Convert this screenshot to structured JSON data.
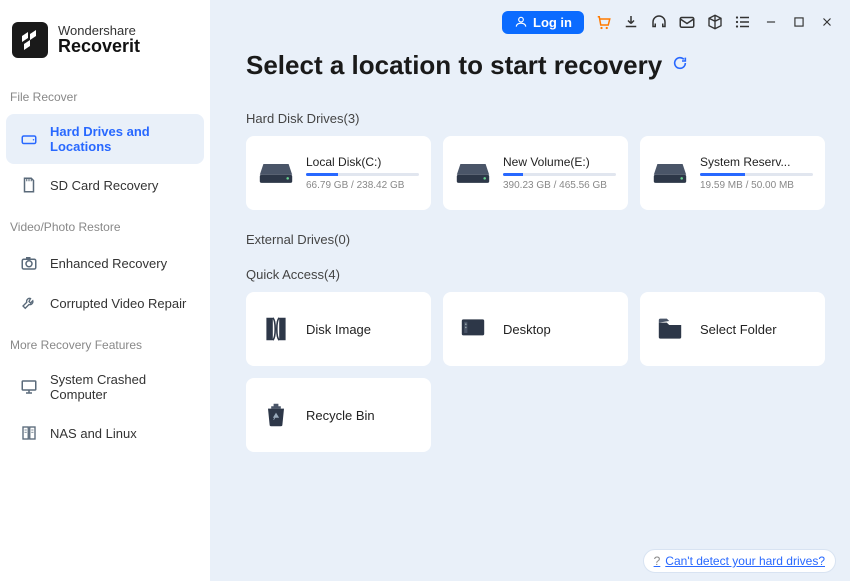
{
  "brand": {
    "line1": "Wondershare",
    "line2": "Recoverit"
  },
  "sidebar": {
    "groups": [
      {
        "label": "File Recover",
        "items": [
          {
            "icon": "drive",
            "label": "Hard Drives and Locations",
            "active": true
          },
          {
            "icon": "sd",
            "label": "SD Card Recovery",
            "active": false
          }
        ]
      },
      {
        "label": "Video/Photo Restore",
        "items": [
          {
            "icon": "camera",
            "label": "Enhanced Recovery",
            "active": false
          },
          {
            "icon": "wrench",
            "label": "Corrupted Video Repair",
            "active": false
          }
        ]
      },
      {
        "label": "More Recovery Features",
        "items": [
          {
            "icon": "monitor",
            "label": "System Crashed Computer",
            "active": false
          },
          {
            "icon": "nas",
            "label": "NAS and Linux",
            "active": false
          }
        ]
      }
    ]
  },
  "titlebar": {
    "login": "Log in",
    "icons": [
      "cart",
      "download",
      "headset",
      "mail",
      "cube",
      "list",
      "minimize",
      "maximize",
      "close"
    ]
  },
  "heading": "Select a location to start recovery",
  "sections": {
    "hdd": {
      "title": "Hard Disk Drives(3)",
      "items": [
        {
          "name": "Local Disk(C:)",
          "used": "66.79 GB",
          "total": "238.42 GB",
          "pct": 28
        },
        {
          "name": "New Volume(E:)",
          "used": "390.23 GB",
          "total": "465.56 GB",
          "pct": 18
        },
        {
          "name": "System Reserv...",
          "used": "19.59 MB",
          "total": "50.00 MB",
          "pct": 40
        }
      ]
    },
    "ext": {
      "title": "External Drives(0)"
    },
    "quick": {
      "title": "Quick Access(4)",
      "items": [
        {
          "icon": "diskimage",
          "label": "Disk Image"
        },
        {
          "icon": "desktop",
          "label": "Desktop"
        },
        {
          "icon": "folder",
          "label": "Select Folder"
        },
        {
          "icon": "recycle",
          "label": "Recycle Bin"
        }
      ]
    }
  },
  "help": {
    "q": "?",
    "text": "Can't detect your hard drives?"
  }
}
